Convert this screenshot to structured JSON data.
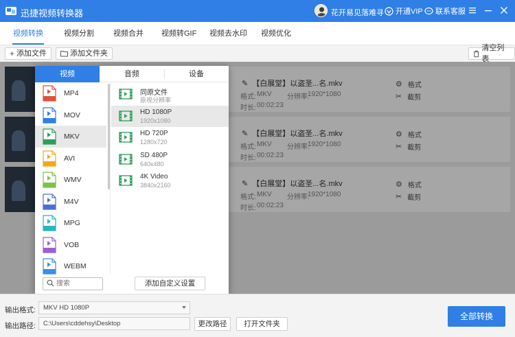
{
  "app": {
    "title": "迅捷视频转换器",
    "user_name": "花开易见落难寻",
    "vip_label": "开通VIP",
    "service_label": "联系客服"
  },
  "tabs": [
    {
      "label": "视频转换",
      "active": true
    },
    {
      "label": "视频分割"
    },
    {
      "label": "视频合并"
    },
    {
      "label": "视频转GIF"
    },
    {
      "label": "视频去水印"
    },
    {
      "label": "视频优化"
    }
  ],
  "toolbar": {
    "add_file": "添加文件",
    "add_folder": "添加文件夹",
    "clear_list": "清空列表"
  },
  "files": [
    {
      "name": "【白展堂】以盗圣...名.mkv",
      "format_label": "格式:",
      "format": "MKV",
      "resolution_label": "分辨率:",
      "resolution": "1920*1080",
      "duration_label": "时长:",
      "duration": "00:02:23",
      "action_format": "格式",
      "action_cut": "截剪"
    },
    {
      "name": "【白展堂】以盗圣...名.mkv",
      "format_label": "格式:",
      "format": "MKV",
      "resolution_label": "分辨率:",
      "resolution": "1920*1080",
      "duration_label": "时长:",
      "duration": "00:02:23",
      "action_format": "格式",
      "action_cut": "截剪"
    },
    {
      "name": "【白展堂】以盗圣...名.mkv",
      "format_label": "格式:",
      "format": "MKV",
      "resolution_label": "分辨率:",
      "resolution": "1920*1080",
      "duration_label": "时长:",
      "duration": "00:02:23",
      "action_format": "格式",
      "action_cut": "截剪"
    }
  ],
  "popup": {
    "tabs": [
      "视频",
      "音频",
      "设备"
    ],
    "formats": [
      {
        "label": "MP4",
        "color": "#e0523a"
      },
      {
        "label": "MOV",
        "color": "#2f7fe6"
      },
      {
        "label": "MKV",
        "color": "#2e9e5b",
        "selected": true
      },
      {
        "label": "AVI",
        "color": "#f0a820"
      },
      {
        "label": "WMV",
        "color": "#7bc24a"
      },
      {
        "label": "M4V",
        "color": "#4a6fd8"
      },
      {
        "label": "MPG",
        "color": "#2bb3c0"
      },
      {
        "label": "VOB",
        "color": "#9b5fd6"
      },
      {
        "label": "WEBM",
        "color": "#3a8ee8"
      }
    ],
    "resolutions": [
      {
        "title": "同原文件",
        "sub": "原视分辨率"
      },
      {
        "title": "HD 1080P",
        "sub": "1920x1080",
        "selected": true
      },
      {
        "title": "HD 720P",
        "sub": "1280x720"
      },
      {
        "title": "SD 480P",
        "sub": "640x480"
      },
      {
        "title": "4K Video",
        "sub": "3840x2160"
      }
    ],
    "search_placeholder": "搜索",
    "custom_button": "添加自定义设置",
    "green": "#2e9e5b"
  },
  "bottom": {
    "output_format_label": "输出格式:",
    "output_format_value": "MKV  HD 1080P",
    "output_path_label": "输出路径:",
    "output_path_value": "C:\\Users\\cddehsy\\Desktop",
    "change_path": "更改路径",
    "open_folder": "打开文件夹",
    "convert_all": "全部转换"
  },
  "colors": {
    "accent": "#2f7fe6"
  }
}
